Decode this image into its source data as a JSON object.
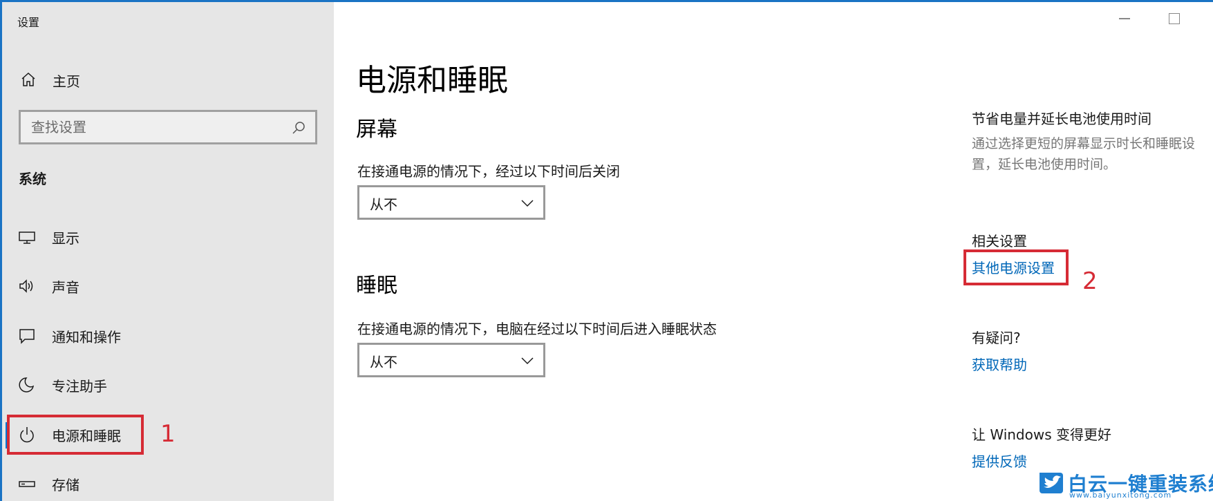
{
  "window": {
    "title": "设置"
  },
  "sidebar": {
    "home_label": "主页",
    "search_placeholder": "查找设置",
    "section_label": "系统",
    "items": [
      {
        "label": "显示",
        "icon": "display-icon"
      },
      {
        "label": "声音",
        "icon": "speaker-icon"
      },
      {
        "label": "通知和操作",
        "icon": "notification-icon"
      },
      {
        "label": "专注助手",
        "icon": "moon-icon"
      },
      {
        "label": "电源和睡眠",
        "icon": "power-icon",
        "selected": true
      },
      {
        "label": "存储",
        "icon": "storage-icon"
      }
    ]
  },
  "main": {
    "title": "电源和睡眠",
    "screen": {
      "heading": "屏幕",
      "label": "在接通电源的情况下，经过以下时间后关闭",
      "value": "从不"
    },
    "sleep": {
      "heading": "睡眠",
      "label": "在接通电源的情况下，电脑在经过以下时间后进入睡眠状态",
      "value": "从不"
    }
  },
  "right": {
    "save_heading": "节省电量并延长电池使用时间",
    "save_desc": "通过选择更短的屏幕显示时长和睡眠设置，延长电池使用时间。",
    "related_heading": "相关设置",
    "related_link": "其他电源设置",
    "question_heading": "有疑问?",
    "help_link": "获取帮助",
    "improve_heading": "让 Windows 变得更好",
    "feedback_link": "提供反馈"
  },
  "annotations": {
    "marker1": "1",
    "marker2": "2",
    "color": "#d62b35"
  },
  "watermark": {
    "title": "白云一键重装系统",
    "url": "www.baiyunxitong.com"
  },
  "colors": {
    "accent": "#0078d7",
    "link": "#0067b8",
    "sidebar_bg": "#e6e6e6"
  }
}
